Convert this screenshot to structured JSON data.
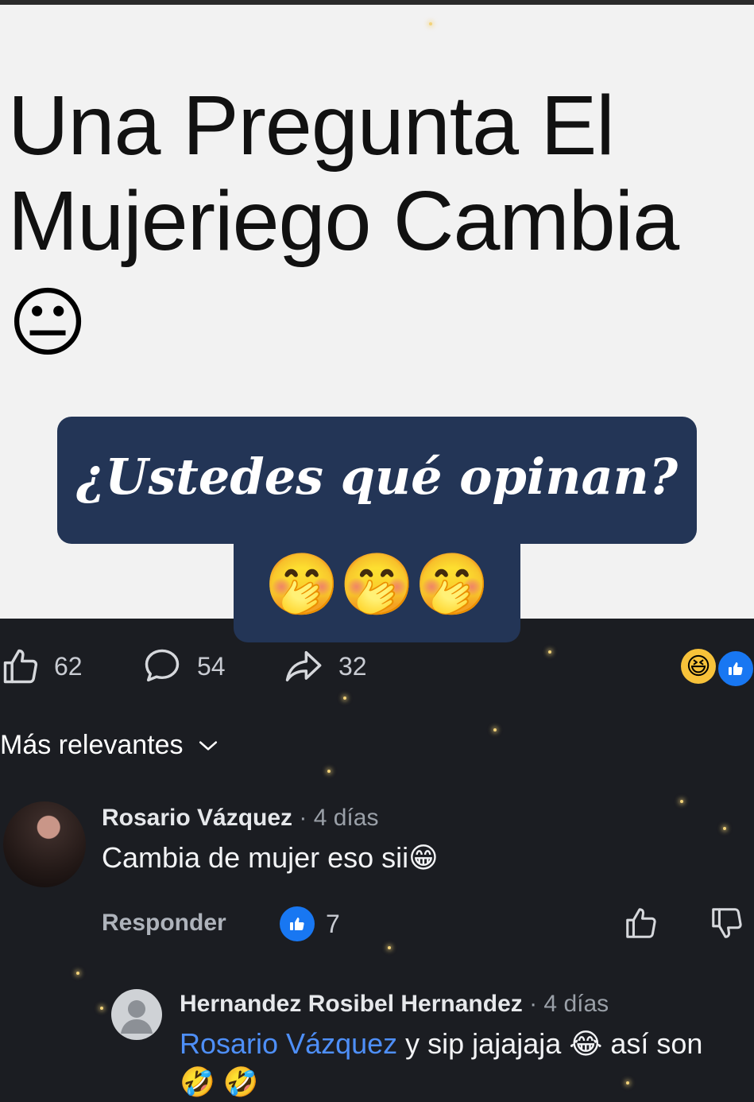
{
  "post": {
    "text": "Una Pregunta El Mujeriego Cambia",
    "emoji": "😐"
  },
  "overlay": {
    "question": "¿Ustedes qué opinan?",
    "emojis": "🤭🤭🤭"
  },
  "stats": {
    "likes": "62",
    "comments": "54",
    "shares": "32"
  },
  "reactions": {
    "laugh": "😆"
  },
  "sort": {
    "label": "Más relevantes"
  },
  "comments": [
    {
      "author": "Rosario Vázquez",
      "meta": " · 4 días",
      "text": "Cambia de mujer eso sii😁",
      "reply_label": "Responder",
      "like_count": "7"
    },
    {
      "author": "Hernandez Rosibel Hernandez",
      "meta": " · 4 días",
      "mention": "Rosario Vázquez",
      "text_line1": " y sip jajajaja 😂 así son",
      "text_line2": "🤣 🤣"
    }
  ],
  "icons": [
    "like-icon",
    "comment-icon",
    "share-icon",
    "chevron-down-icon",
    "thumbs-up-icon",
    "thumbs-down-icon",
    "default-avatar-icon"
  ],
  "colors": {
    "overlay_bg": "#233556",
    "dark_bg": "#1b1d22",
    "mention": "#4e8ff8",
    "like_blue": "#1877f2"
  }
}
